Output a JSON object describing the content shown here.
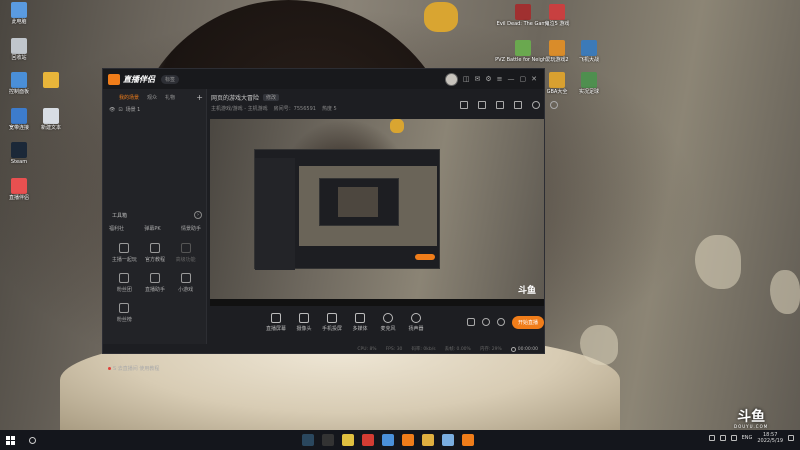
{
  "desktop": {
    "left_icons": [
      {
        "label": "此电脑",
        "icon": "computer-icon",
        "color": "#5a9be0"
      },
      {
        "label": "回收站",
        "icon": "recycle-bin-icon",
        "color": "#c0c6cc"
      },
      {
        "label": "控制面板",
        "icon": "control-panel-icon",
        "color": "#4a8fd8"
      },
      {
        "label": "",
        "icon": "folder-icon",
        "color": "#e8b53a"
      },
      {
        "label": "宽带连接",
        "icon": "network-icon",
        "color": "#3d7ccc"
      },
      {
        "label": "新建文本",
        "icon": "text-file-icon",
        "color": "#d8dde4"
      },
      {
        "label": "Steam",
        "icon": "steam-icon",
        "color": "#1b2838"
      },
      {
        "label": "直播伴侣",
        "icon": "game-icon",
        "color": "#e85050"
      }
    ],
    "right_icons": [
      {
        "label": "Evil Dead: The Game",
        "icon": "game-icon",
        "color": "#a03030"
      },
      {
        "label": "鬼泣5 游戏",
        "icon": "game-icon",
        "color": "#c84040"
      },
      {
        "label": "PVZ Battle for Neigh...",
        "icon": "game-icon",
        "color": "#6aa84f"
      },
      {
        "label": "爱玩游戏2",
        "icon": "game-icon",
        "color": "#d98c2a"
      },
      {
        "label": "飞机大战",
        "icon": "game-icon",
        "color": "#3c7ab8"
      },
      {
        "label": "GBA大全",
        "icon": "game-icon",
        "color": "#d8a030"
      },
      {
        "label": "实况足球",
        "icon": "game-icon",
        "color": "#4f8f4f"
      }
    ]
  },
  "app": {
    "name": "直播伴侣",
    "version": "标签",
    "sidebar": {
      "tabs": [
        {
          "label": "我的场景",
          "active": true
        },
        {
          "label": "观众",
          "active": false
        },
        {
          "label": "礼物",
          "active": false
        }
      ],
      "scene": "场景 1",
      "tools_title": "工具箱",
      "tools_more": "›",
      "tools_row1": [
        "福利社",
        "弹幕PK",
        "情景助手"
      ],
      "tools": [
        {
          "label": "主播一起玩",
          "icon": "clipboard-icon",
          "dim": false
        },
        {
          "label": "官方教程",
          "icon": "book-icon",
          "dim": false
        },
        {
          "label": "高级功能",
          "icon": "upload-icon",
          "dim": true
        },
        {
          "label": "粉丝团",
          "icon": "badge-icon",
          "dim": false
        },
        {
          "label": "直播助手",
          "icon": "cube-icon",
          "dim": false
        },
        {
          "label": "小游戏",
          "icon": "gamepad-icon",
          "dim": false
        },
        {
          "label": "粉丝榜",
          "icon": "triangle-icon",
          "dim": false
        }
      ],
      "bottom_text": "S 去直播间 使用教程"
    },
    "room": {
      "title": "网页的游戏大冒险",
      "edit_label": "修改",
      "meta": [
        "主机游戏/游戏 - 主机游戏",
        "房间号：7556591",
        "热度 5"
      ]
    },
    "bottom_bar": [
      {
        "label": "直播屏幕",
        "icon": "screen-icon"
      },
      {
        "label": "摄像头",
        "icon": "camera-icon"
      },
      {
        "label": "手机投屏",
        "icon": "phone-cast-icon"
      },
      {
        "label": "多媒体",
        "icon": "play-icon"
      },
      {
        "label": "麦克风",
        "icon": "microphone-icon"
      },
      {
        "label": "扬声器",
        "icon": "speaker-icon"
      }
    ],
    "start_live_label": "开始直播",
    "status": {
      "cpu": "CPU: 8%",
      "fps": "FPS: 30",
      "bitrate": "码率: 0kb/s",
      "drop": "丢帧: 0.00%",
      "memory": "内存: 29%",
      "timer": "00:00:00"
    }
  },
  "preview": {
    "watermark": "斗鱼"
  },
  "taskbar": {
    "apps": [
      {
        "icon": "steam-icon",
        "color": "#2a475e"
      },
      {
        "icon": "app-icon",
        "color": "#333333"
      },
      {
        "icon": "game-icon",
        "color": "#e0c040"
      },
      {
        "icon": "netease-music-icon",
        "color": "#d43c33"
      },
      {
        "icon": "app-icon",
        "color": "#4a90d9"
      },
      {
        "icon": "app-icon",
        "color": "#f07d1a"
      },
      {
        "icon": "app-icon",
        "color": "#e0b040"
      },
      {
        "icon": "app-icon",
        "color": "#7aaee0"
      },
      {
        "icon": "app-icon",
        "color": "#f07d1a"
      }
    ],
    "lang": "ENG",
    "time": "18:57",
    "date": "2022/5/19"
  },
  "watermark": {
    "big": "斗鱼",
    "small": "DOUYU.COM"
  }
}
